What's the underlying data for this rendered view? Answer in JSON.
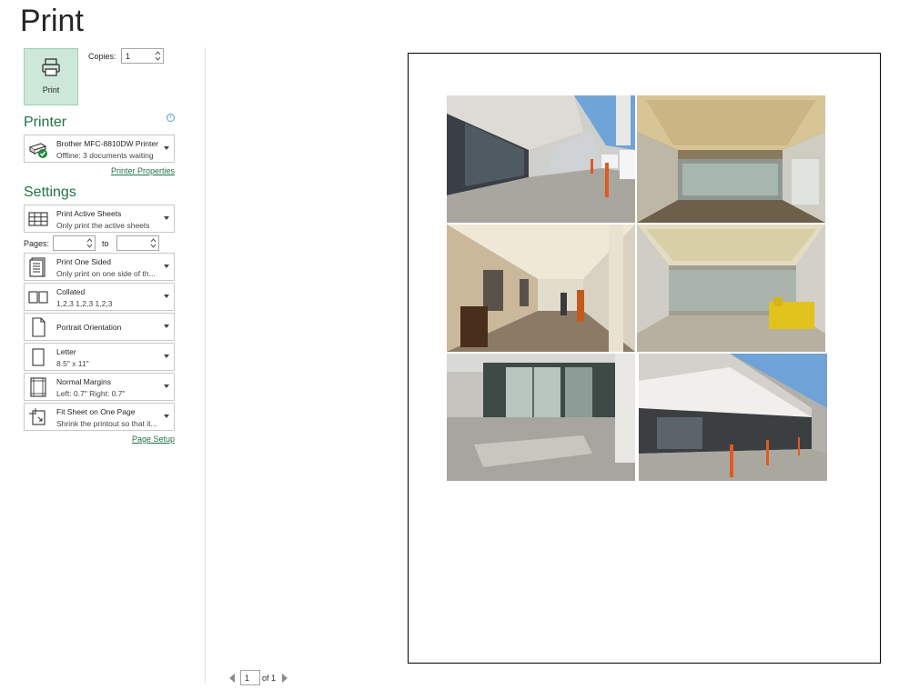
{
  "page_title": "Print",
  "print_button": {
    "label": "Print",
    "icon": "printer-icon"
  },
  "copies": {
    "label": "Copies:",
    "value": "1"
  },
  "printer_section": {
    "heading": "Printer",
    "printer_name": "Brother MFC-8810DW Printer",
    "printer_status": "Offline: 3 documents waiting",
    "properties_link": "Printer Properties",
    "info_icon": "info-icon"
  },
  "settings_section": {
    "heading": "Settings",
    "sheets": {
      "line1": "Print Active Sheets",
      "line2": "Only print the active sheets"
    },
    "pages": {
      "label": "Pages:",
      "from_value": "",
      "to_label": "to",
      "to_value": ""
    },
    "sides": {
      "line1": "Print One Sided",
      "line2": "Only print on one side of th..."
    },
    "collation": {
      "line1": "Collated",
      "line2": "1,2,3    1,2,3    1,2,3"
    },
    "orientation": {
      "line1": "Portrait Orientation"
    },
    "paper": {
      "line1": "Letter",
      "line2": "8.5\" x 11\""
    },
    "margins": {
      "line1": "Normal Margins",
      "line2": "Left:  0.7\"    Right:  0.7\""
    },
    "scaling": {
      "line1": "Fit Sheet on One Page",
      "line2": "Shrink the printout so that it..."
    },
    "page_setup_link": "Page Setup"
  },
  "pager": {
    "current": "1",
    "of_label": "of 1"
  },
  "colors": {
    "accent": "#217346",
    "print_button_bg": "#cde8d9"
  },
  "preview_photos": [
    "building-exterior-walkway",
    "lobby-cove-lighting",
    "elevator-hallway",
    "lobby-empty-room",
    "glass-entrance-doors",
    "building-canopy-entrance"
  ]
}
